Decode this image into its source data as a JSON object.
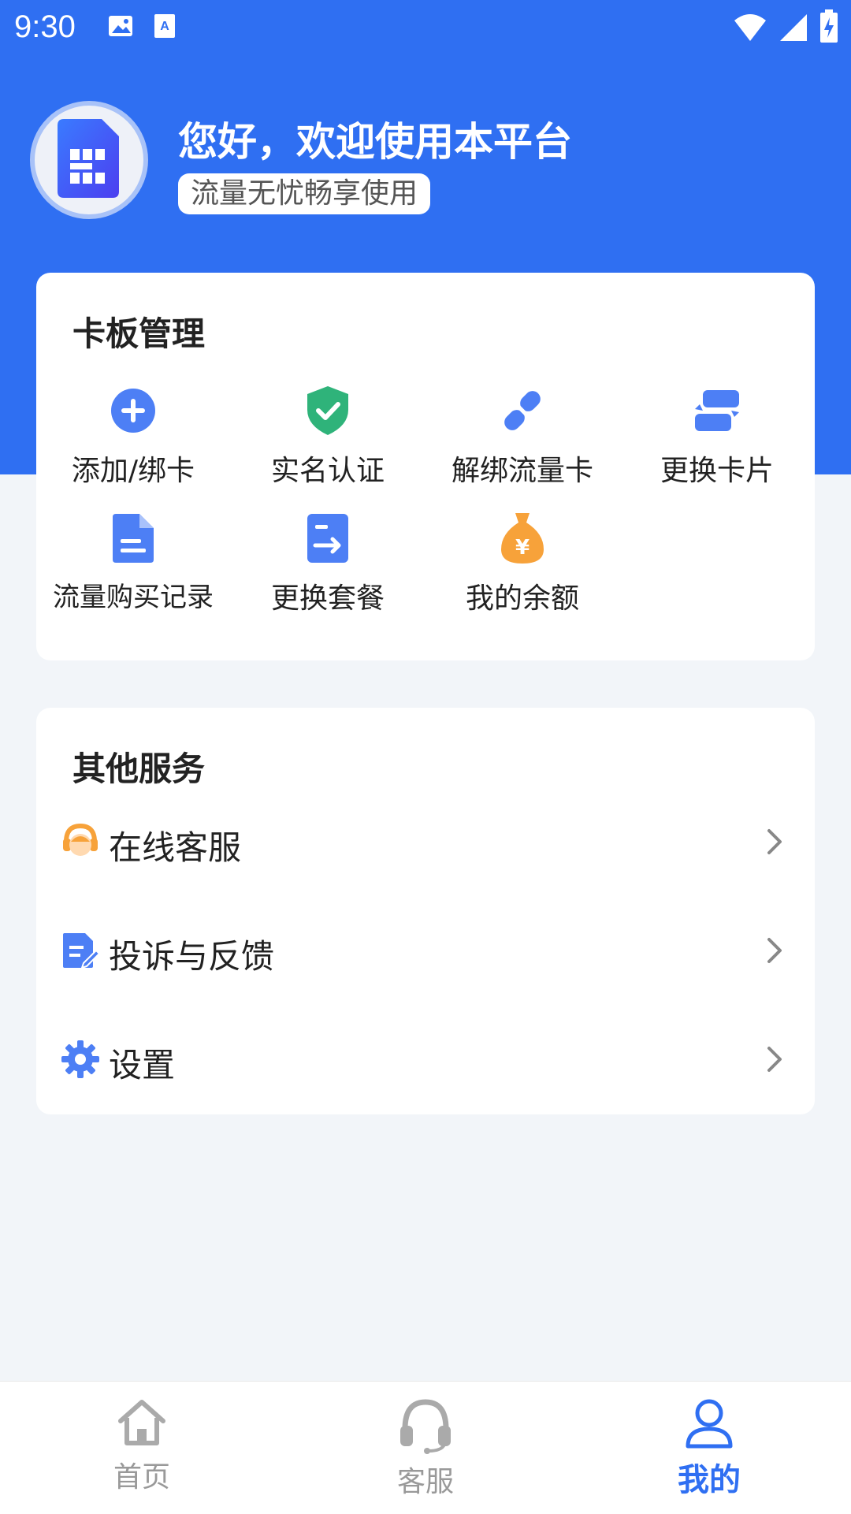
{
  "status_bar": {
    "time": "9:30",
    "left_icons": [
      "image-icon",
      "text-a-icon"
    ],
    "right_icons": [
      "wifi-icon",
      "cell-signal-icon",
      "battery-charging-icon"
    ]
  },
  "profile": {
    "greeting": "您好，欢迎使用本平台",
    "subtitle": "流量无忧畅享使用",
    "avatar_icon": "sim-card-icon"
  },
  "card_management": {
    "title": "卡板管理",
    "items": [
      {
        "label": "添加/绑卡",
        "icon": "add-circle-icon"
      },
      {
        "label": "实名认证",
        "icon": "shield-check-icon"
      },
      {
        "label": "解绑流量卡",
        "icon": "unlink-icon"
      },
      {
        "label": "更换卡片",
        "icon": "swap-icon"
      },
      {
        "label": "流量购买记录",
        "icon": "document-icon"
      },
      {
        "label": "更换套餐",
        "icon": "document-arrow-icon"
      },
      {
        "label": "我的余额",
        "icon": "money-bag-icon"
      }
    ]
  },
  "other_services": {
    "title": "其他服务",
    "items": [
      {
        "label": "在线客服",
        "icon": "customer-service-icon"
      },
      {
        "label": "投诉与反馈",
        "icon": "feedback-edit-icon"
      },
      {
        "label": "设置",
        "icon": "gear-icon"
      }
    ]
  },
  "bottom_nav": {
    "items": [
      {
        "label": "首页",
        "icon": "home-icon"
      },
      {
        "label": "客服",
        "icon": "headset-icon"
      },
      {
        "label": "我的",
        "icon": "user-icon"
      }
    ],
    "active": "我的"
  },
  "colors": {
    "primary": "#2f6ff2",
    "icon_blue": "#4d7ff5",
    "icon_green": "#2fb37a",
    "icon_orange": "#f7a23a",
    "background": "#f2f5f9"
  }
}
